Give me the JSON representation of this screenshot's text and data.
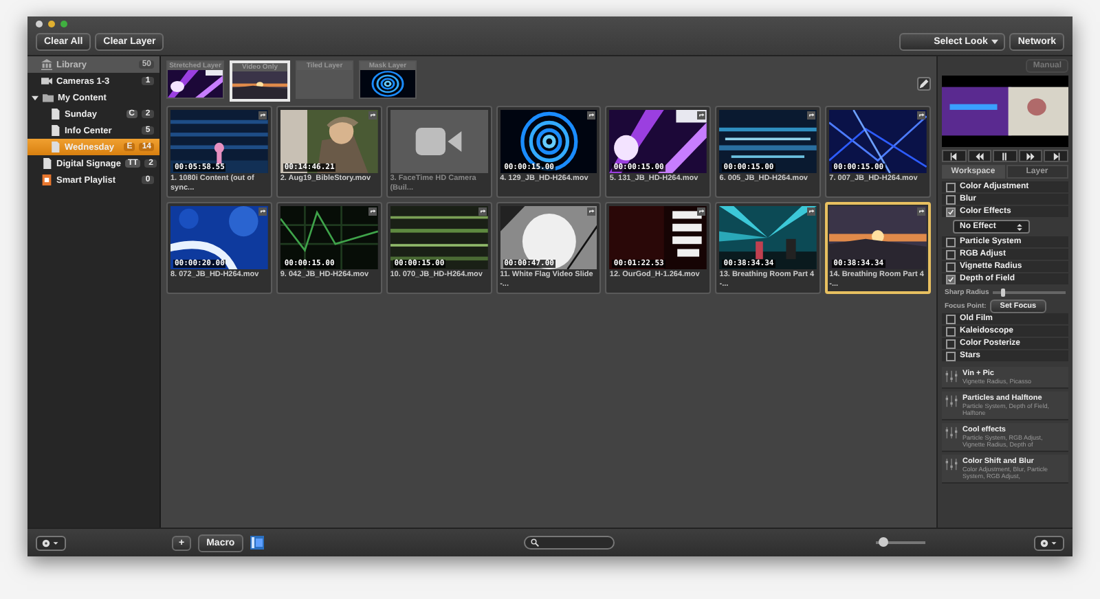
{
  "toolbar": {
    "buttons": [
      "Clear All",
      "Clear Layer"
    ],
    "look_select": "Select Look",
    "network_button": "Network"
  },
  "sidebar": {
    "items": [
      {
        "kind": "library",
        "label": "Library",
        "count": "50",
        "selected": false
      },
      {
        "kind": "camera",
        "label": "Cameras 1-3",
        "count": "1",
        "selected": false
      },
      {
        "kind": "folder",
        "label": "My Content",
        "expanded": true,
        "selected": false,
        "children": [
          {
            "kind": "document",
            "label": "Sunday",
            "key": "C",
            "count": "2",
            "selected": false
          },
          {
            "kind": "document",
            "label": "Info Center",
            "count": "5",
            "selected": false
          },
          {
            "kind": "document",
            "label": "Wednesday",
            "key": "E",
            "count": "14",
            "selected": true
          }
        ]
      },
      {
        "kind": "document",
        "label": "Digital Signage",
        "key": "TT",
        "count": "2",
        "selected": false
      },
      {
        "kind": "smart",
        "label": "Smart Playlist",
        "count": "0",
        "selected": false
      }
    ]
  },
  "layers": [
    {
      "label": "Stretched Layer",
      "kind": "picture",
      "selected": false
    },
    {
      "label": "Video Only",
      "kind": "picture",
      "selected": true
    },
    {
      "label": "Tiled Layer",
      "kind": "empty",
      "selected": false
    },
    {
      "label": "Mask Layer",
      "kind": "picture",
      "selected": false
    }
  ],
  "clips": [
    {
      "kind": "video",
      "time": "00:05:58.55",
      "name": "1. 1080i Content (out of sync...",
      "selected": false
    },
    {
      "kind": "video",
      "time": "00:14:46.21",
      "name": "2. Aug19_BibleStory.mov",
      "selected": false
    },
    {
      "kind": "camera",
      "name": "3. FaceTime HD Camera (Buil...",
      "selected": false
    },
    {
      "kind": "video",
      "time": "00:00:15.00",
      "name": "4. 129_JB_HD-H264.mov",
      "selected": false
    },
    {
      "kind": "video",
      "time": "00:00:15.00",
      "name": "5. 131_JB_HD-H264.mov",
      "selected": false
    },
    {
      "kind": "video",
      "time": "00:00:15.00",
      "name": "6. 005_JB_HD-H264.mov",
      "selected": false
    },
    {
      "kind": "video",
      "time": "00:00:15.00",
      "name": "7. 007_JB_HD-H264.mov",
      "selected": false
    },
    {
      "kind": "video",
      "time": "00:00:20.00",
      "name": "8. 072_JB_HD-H264.mov",
      "selected": false
    },
    {
      "kind": "video",
      "time": "00:00:15.00",
      "name": "9. 042_JB_HD-H264.mov",
      "selected": false
    },
    {
      "kind": "video",
      "time": "00:00:15.00",
      "name": "10. 070_JB_HD-H264.mov",
      "selected": false
    },
    {
      "kind": "video",
      "time": "00:00:47.00",
      "name": "11. White Flag Video Slide -...",
      "selected": false
    },
    {
      "kind": "video",
      "time": "00:01:22.53",
      "name": "12. OurGod_H-1.264.mov",
      "selected": false
    },
    {
      "kind": "video",
      "time": "00:38:34.34",
      "name": "13. Breathing Room Part 4 -...",
      "selected": false
    },
    {
      "kind": "video",
      "time": "00:38:34.34",
      "name": "14. Breathing Room Part 4 -...",
      "selected": true
    }
  ],
  "panel": {
    "manual_button": "Manual",
    "tabs": [
      {
        "label": "Workspace",
        "selected": true
      },
      {
        "label": "Layer",
        "selected": false
      }
    ],
    "effects": [
      {
        "kind": "check",
        "label": "Color Adjustment",
        "checked": false
      },
      {
        "kind": "check",
        "label": "Blur",
        "checked": false
      },
      {
        "kind": "check",
        "label": "Color Effects",
        "checked": true
      },
      {
        "kind": "select",
        "value": "No Effect"
      },
      {
        "kind": "check",
        "label": "Particle System",
        "checked": false
      },
      {
        "kind": "check",
        "label": "RGB Adjust",
        "checked": false
      },
      {
        "kind": "check",
        "label": "Vignette Radius",
        "checked": false
      },
      {
        "kind": "check",
        "label": "Depth of Field",
        "checked": true
      },
      {
        "kind": "slider",
        "label": "Sharp Radius",
        "level": 0.1
      },
      {
        "kind": "button",
        "label": "Focus Point:",
        "button": "Set Focus"
      },
      {
        "kind": "check",
        "label": "Old Film",
        "checked": false
      },
      {
        "kind": "check",
        "label": "Kaleidoscope",
        "checked": false
      },
      {
        "kind": "check",
        "label": "Color Posterize",
        "checked": false
      },
      {
        "kind": "check",
        "label": "Stars",
        "checked": false
      }
    ],
    "looks": [
      {
        "title": "Vin + Pic",
        "detail": "Vignette Radius, Picasso"
      },
      {
        "title": "Particles and Halftone",
        "detail": "Particle System, Depth of Field, Halftone"
      },
      {
        "title": "Cool effects",
        "detail": "Particle System, RGB Adjust, Vignette Radius, Depth of"
      },
      {
        "title": "Color Shift and Blur",
        "detail": "Color Adjustment, Blur, Particle System, RGB Adjust,"
      }
    ]
  },
  "bottom": {
    "add_button": "+",
    "macro_button": "Macro",
    "zoom_slider": {
      "level": 0.05
    }
  }
}
